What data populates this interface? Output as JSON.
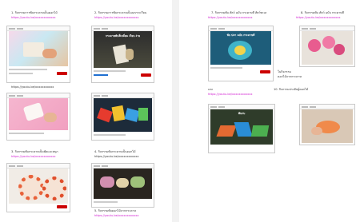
{
  "left_page": {
    "items": [
      {
        "caption": "1. กิจกรรมการพับกระดาษเป็นดอกไม้",
        "link": "https://youtu.be/xxxxxxxxxxxx",
        "video_title": ""
      },
      {
        "caption": "2. กิจกรรมการพับกระดาษเป็นนกกระเรียน",
        "link": "https://youtu.be/xxxxxxxxxxxx",
        "video_title": "กระดาษพับสี่เหลี่ยม เรียบ ง่าย"
      },
      {
        "caption": "3. กิจกรรมพับกระดาษเป็นพัดและสนุก",
        "link": "https://youtu.be/xxxxxxxxxxxx",
        "video_title": ""
      },
      {
        "caption": "4. กิจกรรมพับกระดาษเป็นดอกไม้",
        "link": "https://youtu.be/xxxxxxxxxxxx",
        "video_title": ""
      },
      {
        "caption": "5. กิจกรรมพับดอกไม้จากกระดาษ",
        "link": "https://youtu.be/xxxxxxxxxxxx",
        "video_title": ""
      }
    ],
    "standalone_link": "https://youtu.be/xxxxxxxxxxx"
  },
  "right_page": {
    "items": [
      {
        "caption": "7. กิจกรรมพับ สัตว์ ฉบับ กระดาษสี สัตว์ทะเล",
        "link": "https://youtu.be/xxxxxxxxxxxx",
        "video_title": "พับ ปลา ฉบับ กระดาษสี"
      },
      {
        "caption": "8. กิจกรรมพับ สัตว์ ฉบับ กระดาษสี",
        "link": "https://youtu.be/xxxxxxxxxxxx",
        "video_title": ""
      },
      {
        "caption": "9. กิจกรรมพับ",
        "link": "https://youtu.be/xxxxxxxxxxxx",
        "video_title": "พับกบ"
      },
      {
        "caption": "10. กิจกรรมประดิษฐ์ดอกไม้",
        "link": "",
        "video_title": ""
      }
    ],
    "fragment_a": "ในกิจกรรม",
    "fragment_b": "ดอกไม้จากกระดาษ",
    "fragment_c": "และ"
  },
  "colors": {
    "link": "#d01ad0",
    "page": "#ffffff",
    "gutter": "#f2f2f2",
    "subscribe": "#cc0000"
  }
}
